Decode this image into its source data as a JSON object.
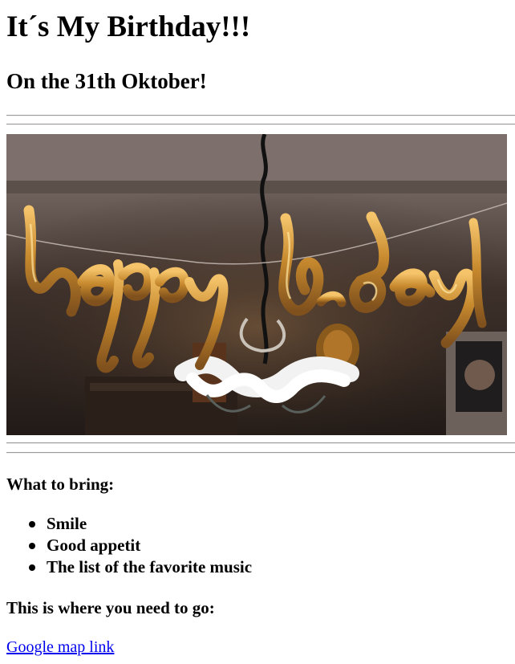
{
  "page": {
    "title": "It´s My Birthday!!!",
    "subtitle": "On the 31th Oktober!",
    "image": {
      "decorative_text": "happy b-day",
      "description_icon": "birthday-balloons-image"
    },
    "bring_heading": "What to bring:",
    "bring_items": [
      "Smile",
      "Good appetit",
      "The list of the favorite music"
    ],
    "directions_heading": "This is where you need to go:",
    "map_link_text": "Google map link"
  },
  "colors": {
    "link": "#0000ee",
    "text": "#000000",
    "rule": "#9a9a9a",
    "image_background": "#2b201b",
    "balloon_gold": "#c88a2e"
  }
}
